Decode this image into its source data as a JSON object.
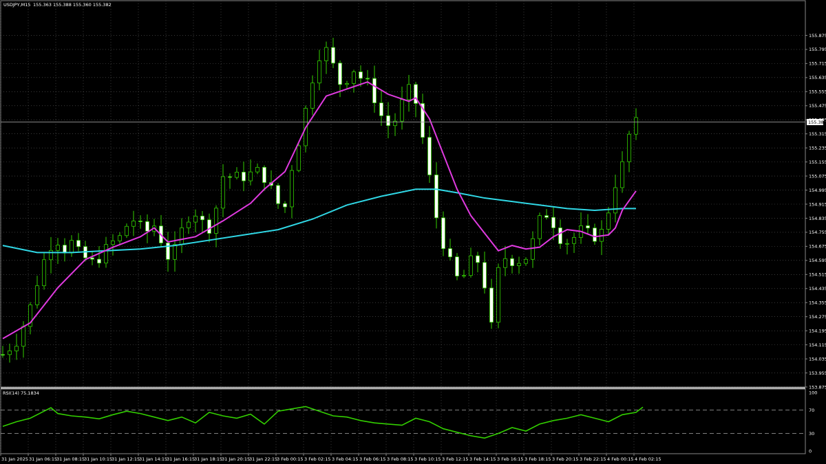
{
  "header": {
    "symbol": "USDJPY,M15",
    "ohlc": "155.363 155.388 155.360 155.382"
  },
  "rsi_header": "RSI(14) 75.1834",
  "price_tag": "155.382",
  "colors": {
    "background": "#000000",
    "grid": "#606060",
    "candle_up_fill": "#000000",
    "candle_down_fill": "#ffffff",
    "candle_stroke": "#33d000",
    "ma_fast": "#e03ae0",
    "ma_slow": "#30d8e6",
    "rsi_line": "#33d000",
    "text": "#ffffff"
  },
  "chart_data": [
    {
      "type": "candlestick",
      "symbol": "USDJPY",
      "timeframe": "M15",
      "y_ticks": [
        "155.875",
        "155.795",
        "155.715",
        "155.635",
        "155.555",
        "155.475",
        "155.395",
        "155.315",
        "155.235",
        "155.155",
        "155.075",
        "154.995",
        "154.915",
        "154.835",
        "154.755",
        "154.675",
        "154.595",
        "154.515",
        "154.435",
        "154.355",
        "154.275",
        "154.195",
        "154.115",
        "154.035",
        "153.955",
        "153.875"
      ],
      "ylim": [
        153.875,
        155.955
      ],
      "x_ticks": [
        "31 Jan 2025",
        "31 Jan 06:15",
        "31 Jan 08:15",
        "31 Jan 10:15",
        "31 Jan 12:15",
        "31 Jan 14:15",
        "31 Jan 16:15",
        "31 Jan 18:15",
        "31 Jan 20:15",
        "31 Jan 22:15",
        "3 Feb 00:15",
        "3 Feb 02:15",
        "3 Feb 04:15",
        "3 Feb 06:15",
        "3 Feb 08:15",
        "3 Feb 10:15",
        "3 Feb 12:15",
        "3 Feb 14:15",
        "3 Feb 16:15",
        "3 Feb 18:15",
        "3 Feb 20:15",
        "3 Feb 22:15",
        "4 Feb 00:15",
        "4 Feb 02:15"
      ],
      "close_path": [
        [
          0,
          154.06
        ],
        [
          1,
          154.1
        ],
        [
          2,
          154.14
        ],
        [
          3,
          154.26
        ],
        [
          4,
          154.38
        ],
        [
          5,
          154.55
        ],
        [
          6,
          154.66
        ],
        [
          7,
          154.72
        ],
        [
          8,
          154.65
        ],
        [
          9,
          154.7
        ],
        [
          10,
          154.64
        ],
        [
          11,
          154.6
        ],
        [
          12,
          154.58
        ],
        [
          13,
          154.62
        ],
        [
          14,
          154.7
        ],
        [
          15,
          154.7
        ],
        [
          16,
          154.78
        ],
        [
          17,
          154.83
        ],
        [
          18,
          154.79
        ],
        [
          19,
          154.76
        ],
        [
          20,
          154.8
        ],
        [
          21,
          154.68
        ],
        [
          22,
          154.58
        ],
        [
          23,
          154.72
        ],
        [
          24,
          154.82
        ],
        [
          25,
          154.88
        ],
        [
          26,
          154.82
        ],
        [
          27,
          154.77
        ],
        [
          28,
          154.9
        ],
        [
          29,
          155.1
        ],
        [
          30,
          155.06
        ],
        [
          31,
          155.08
        ],
        [
          32,
          155.06
        ],
        [
          33,
          155.12
        ],
        [
          34,
          155.08
        ],
        [
          35,
          155.02
        ],
        [
          36,
          154.92
        ],
        [
          37,
          154.9
        ],
        [
          38,
          155.15
        ],
        [
          39,
          155.3
        ],
        [
          40,
          155.52
        ],
        [
          41,
          155.7
        ],
        [
          42,
          155.82
        ],
        [
          43,
          155.75
        ],
        [
          44,
          155.6
        ],
        [
          45,
          155.62
        ],
        [
          46,
          155.68
        ],
        [
          47,
          155.63
        ],
        [
          48,
          155.6
        ],
        [
          49,
          155.48
        ],
        [
          50,
          155.38
        ],
        [
          51,
          155.35
        ],
        [
          52,
          155.45
        ],
        [
          53,
          155.58
        ],
        [
          54,
          155.52
        ],
        [
          55,
          155.3
        ],
        [
          56,
          155.05
        ],
        [
          57,
          154.8
        ],
        [
          58,
          154.65
        ],
        [
          59,
          154.55
        ],
        [
          60,
          154.45
        ],
        [
          61,
          154.58
        ],
        [
          62,
          154.62
        ],
        [
          63,
          154.5
        ],
        [
          64,
          154.2
        ],
        [
          65,
          154.55
        ],
        [
          66,
          154.62
        ],
        [
          67,
          154.58
        ],
        [
          68,
          154.6
        ],
        [
          69,
          154.62
        ],
        [
          70,
          154.8
        ],
        [
          71,
          154.87
        ],
        [
          72,
          154.82
        ],
        [
          73,
          154.72
        ],
        [
          74,
          154.7
        ],
        [
          75,
          154.73
        ],
        [
          76,
          154.78
        ],
        [
          77,
          154.74
        ],
        [
          78,
          154.72
        ],
        [
          79,
          154.8
        ],
        [
          80,
          155.0
        ],
        [
          81,
          155.1
        ],
        [
          82,
          155.3
        ],
        [
          83,
          155.38
        ]
      ],
      "ma_fast": [
        [
          0,
          154.15
        ],
        [
          4,
          154.24
        ],
        [
          8,
          154.44
        ],
        [
          12,
          154.6
        ],
        [
          16,
          154.67
        ],
        [
          20,
          154.73
        ],
        [
          22,
          154.78
        ],
        [
          24,
          154.7
        ],
        [
          28,
          154.73
        ],
        [
          32,
          154.82
        ],
        [
          36,
          154.92
        ],
        [
          38,
          155.0
        ],
        [
          41,
          155.1
        ],
        [
          44,
          155.35
        ],
        [
          47,
          155.53
        ],
        [
          50,
          155.57
        ],
        [
          53,
          155.61
        ],
        [
          56,
          155.54
        ],
        [
          59,
          155.5
        ],
        [
          60,
          155.52
        ],
        [
          62,
          155.4
        ],
        [
          64,
          155.2
        ],
        [
          66,
          155.0
        ],
        [
          68,
          154.85
        ],
        [
          70,
          154.75
        ],
        [
          72,
          154.65
        ],
        [
          74,
          154.68
        ],
        [
          76,
          154.66
        ],
        [
          78,
          154.67
        ],
        [
          80,
          154.73
        ],
        [
          82,
          154.77
        ],
        [
          84,
          154.76
        ],
        [
          86,
          154.73
        ],
        [
          88,
          154.74
        ],
        [
          89,
          154.78
        ],
        [
          90,
          154.88
        ],
        [
          92,
          154.99
        ]
      ],
      "ma_slow": [
        [
          0,
          154.68
        ],
        [
          5,
          154.64
        ],
        [
          10,
          154.64
        ],
        [
          15,
          154.65
        ],
        [
          20,
          154.66
        ],
        [
          25,
          154.68
        ],
        [
          30,
          154.71
        ],
        [
          35,
          154.74
        ],
        [
          40,
          154.77
        ],
        [
          45,
          154.83
        ],
        [
          50,
          154.91
        ],
        [
          55,
          154.96
        ],
        [
          60,
          155.0
        ],
        [
          63,
          155.0
        ],
        [
          66,
          154.98
        ],
        [
          70,
          154.95
        ],
        [
          74,
          154.93
        ],
        [
          78,
          154.91
        ],
        [
          82,
          154.89
        ],
        [
          86,
          154.88
        ],
        [
          90,
          154.89
        ],
        [
          92,
          154.89
        ]
      ]
    },
    {
      "type": "line",
      "title": "RSI(14) 75.1834",
      "y_ticks": [
        "100",
        "70",
        "30",
        "0"
      ],
      "ylim": [
        0,
        100
      ],
      "levels": [
        70,
        30
      ],
      "series": [
        {
          "values": [
            [
              0,
              42
            ],
            [
              2,
              50
            ],
            [
              4,
              56
            ],
            [
              6,
              68
            ],
            [
              7,
              74
            ],
            [
              8,
              64
            ],
            [
              10,
              60
            ],
            [
              12,
              58
            ],
            [
              14,
              55
            ],
            [
              16,
              62
            ],
            [
              18,
              68
            ],
            [
              20,
              64
            ],
            [
              22,
              58
            ],
            [
              24,
              52
            ],
            [
              26,
              58
            ],
            [
              28,
              48
            ],
            [
              30,
              66
            ],
            [
              32,
              60
            ],
            [
              34,
              56
            ],
            [
              36,
              63
            ],
            [
              38,
              46
            ],
            [
              40,
              68
            ],
            [
              42,
              72
            ],
            [
              44,
              76
            ],
            [
              46,
              68
            ],
            [
              48,
              60
            ],
            [
              50,
              58
            ],
            [
              52,
              52
            ],
            [
              54,
              48
            ],
            [
              56,
              46
            ],
            [
              58,
              44
            ],
            [
              60,
              56
            ],
            [
              62,
              50
            ],
            [
              64,
              38
            ],
            [
              66,
              32
            ],
            [
              68,
              26
            ],
            [
              70,
              22
            ],
            [
              72,
              30
            ],
            [
              74,
              40
            ],
            [
              76,
              34
            ],
            [
              78,
              46
            ],
            [
              80,
              52
            ],
            [
              82,
              56
            ],
            [
              84,
              62
            ],
            [
              86,
              56
            ],
            [
              88,
              50
            ],
            [
              90,
              62
            ],
            [
              92,
              66
            ],
            [
              93,
              75
            ]
          ]
        }
      ]
    }
  ]
}
